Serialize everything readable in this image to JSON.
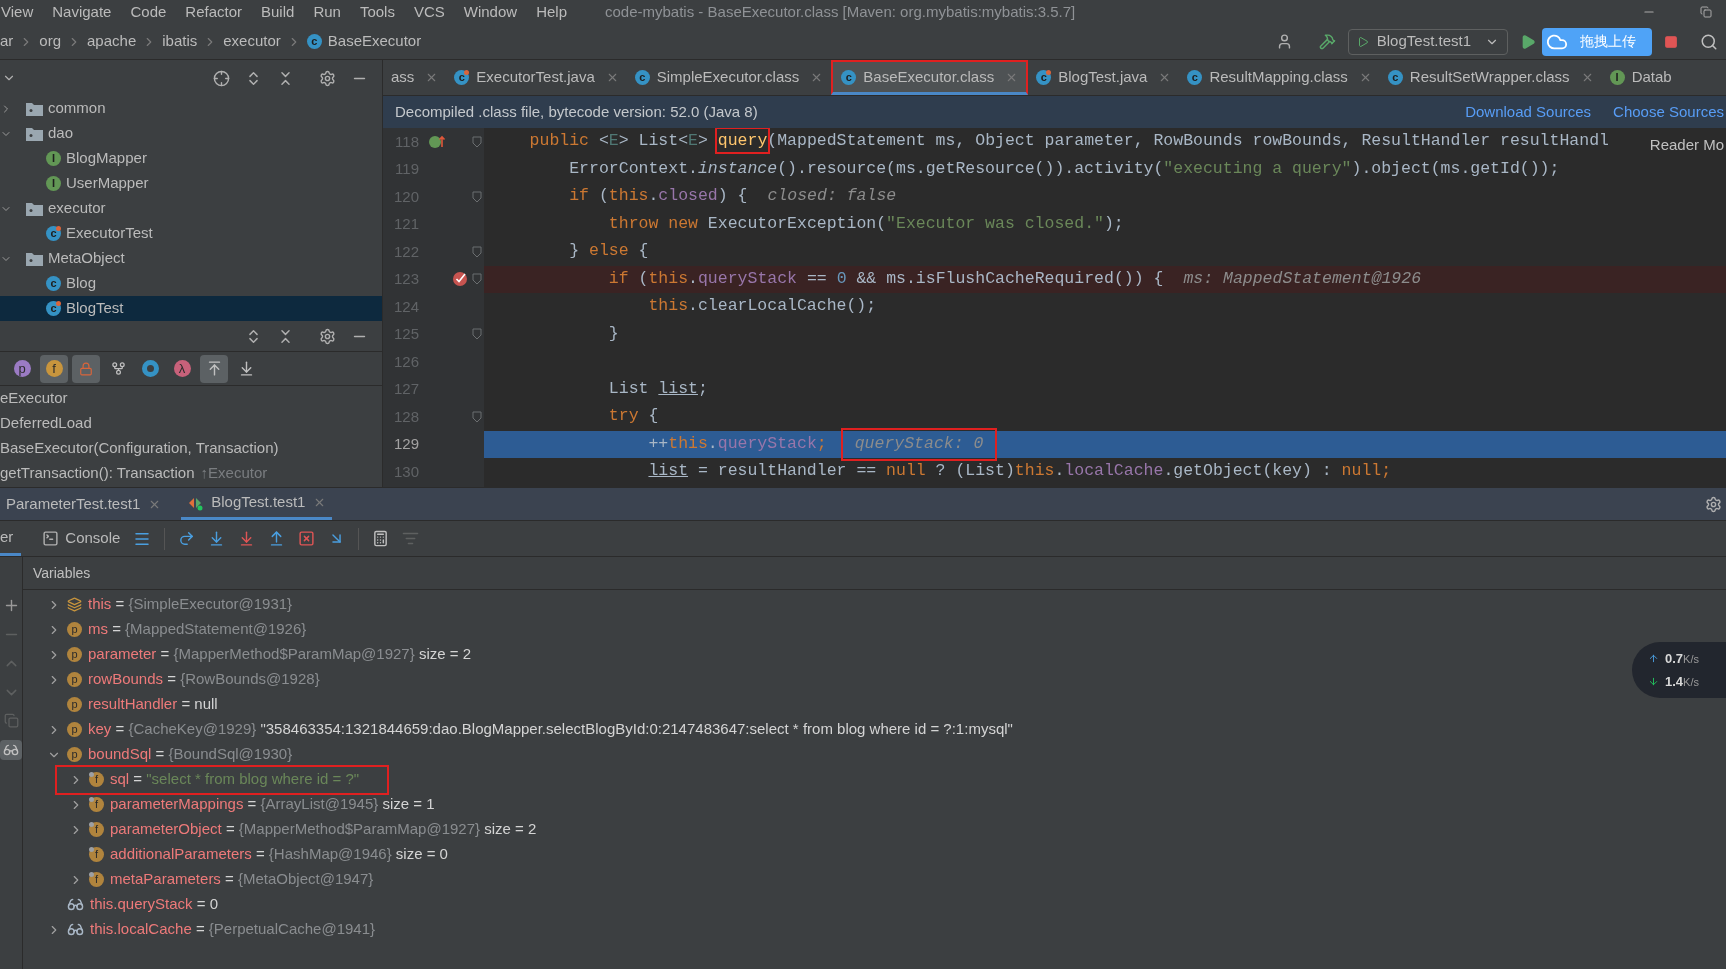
{
  "menu": [
    "View",
    "Navigate",
    "Code",
    "Refactor",
    "Build",
    "Run",
    "Tools",
    "VCS",
    "Window",
    "Help"
  ],
  "window": {
    "title": "code-mybatis - BaseExecutor.class [Maven: org.mybatis:mybatis:3.5.7]"
  },
  "breadcrumbs": [
    {
      "label": "ar"
    },
    {
      "label": "org"
    },
    {
      "label": "apache"
    },
    {
      "label": "ibatis"
    },
    {
      "label": "executor"
    },
    {
      "label": "BaseExecutor",
      "glyph": "c"
    }
  ],
  "run_config": {
    "label": "BlogTest.test1"
  },
  "upload_button": {
    "label": "拖拽上传"
  },
  "project_tree": [
    {
      "label": "common",
      "kind": "folder",
      "expanded": false,
      "selected": false
    },
    {
      "label": "dao",
      "kind": "folder",
      "expanded": true,
      "selected": false,
      "children": [
        {
          "label": "BlogMapper",
          "kind": "interface",
          "glyph": "I",
          "selected": false
        },
        {
          "label": "UserMapper",
          "kind": "interface",
          "glyph": "I",
          "selected": false
        }
      ]
    },
    {
      "label": "executor",
      "kind": "folder",
      "expanded": true,
      "selected": false,
      "children": [
        {
          "label": "ExecutorTest",
          "kind": "test",
          "glyph": "c",
          "selected": false
        }
      ]
    },
    {
      "label": "MetaObject",
      "kind": "folder",
      "expanded": true,
      "selected": false,
      "children": [
        {
          "label": "Blog",
          "kind": "class",
          "glyph": "c",
          "selected": false
        },
        {
          "label": "BlogTest",
          "kind": "test",
          "glyph": "c",
          "selected": true
        }
      ]
    }
  ],
  "structure_filters": [
    {
      "kind": "property",
      "glyph": "p",
      "selected": false
    },
    {
      "kind": "field",
      "glyph": "f",
      "selected": true
    },
    {
      "kind": "lock",
      "selected": true
    },
    {
      "kind": "fork",
      "selected": false
    },
    {
      "kind": "ring",
      "selected": false
    },
    {
      "kind": "lambda",
      "glyph": "λ",
      "selected": false
    },
    {
      "kind": "inherited",
      "selected": true
    },
    {
      "kind": "down",
      "selected": false
    }
  ],
  "structure_items": [
    {
      "label": "eExecutor"
    },
    {
      "label": "DeferredLoad"
    },
    {
      "label": "BaseExecutor(Configuration, Transaction)"
    },
    {
      "label": "getTransaction(): Transaction",
      "origin": "↑Executor"
    }
  ],
  "editor_tabs": [
    {
      "label": "ass",
      "selected": false,
      "close": true
    },
    {
      "label": "ExecutorTest.java",
      "kind": "test",
      "glyph": "c",
      "selected": false,
      "close": true
    },
    {
      "label": "SimpleExecutor.class",
      "kind": "class",
      "glyph": "c",
      "selected": false,
      "close": true
    },
    {
      "label": "BaseExecutor.class",
      "kind": "class",
      "glyph": "c",
      "selected": true,
      "close": true,
      "boxed": true
    },
    {
      "label": "BlogTest.java",
      "kind": "test",
      "glyph": "c",
      "selected": false,
      "close": true
    },
    {
      "label": "ResultMapping.class",
      "kind": "class",
      "glyph": "c",
      "selected": false,
      "close": true
    },
    {
      "label": "ResultSetWrapper.class",
      "kind": "class",
      "glyph": "c",
      "selected": false,
      "close": true
    },
    {
      "label": "Datab",
      "kind": "interface",
      "glyph": "I",
      "selected": false,
      "close": false
    }
  ],
  "banner": {
    "text": "Decompiled .class file, bytecode version: 52.0 (Java 8)",
    "links": [
      "Download Sources",
      "Choose Sources"
    ]
  },
  "reader_mode": "Reader Mo",
  "code_lines": [
    {
      "number": "118",
      "kind": "override",
      "fold": true,
      "current": false,
      "tokens": [
        {
          "text": "    public",
          "kind": "kw"
        },
        {
          "text": " <",
          "kind": "plain"
        },
        {
          "text": "E",
          "kind": "type"
        },
        {
          "text": "> List<",
          "kind": "plain"
        },
        {
          "text": "E",
          "kind": "type"
        },
        {
          "text": "> ",
          "kind": "plain"
        },
        {
          "text": "query",
          "kind": "fn",
          "boxed": true
        },
        {
          "text": "(MappedStatement ms, Object parameter, RowBounds rowBounds, ResultHandler resultHandl",
          "kind": "plain"
        }
      ]
    },
    {
      "number": "119",
      "kind": "plain",
      "fold": false,
      "current": false,
      "tokens": [
        {
          "text": "        ErrorContext.",
          "kind": "plain"
        },
        {
          "text": "instance",
          "kind": "italic"
        },
        {
          "text": "().resource(ms.getResource()).activity(",
          "kind": "plain"
        },
        {
          "text": "\"executing a query\"",
          "kind": "str"
        },
        {
          "text": ").object(ms.getId());",
          "kind": "plain"
        }
      ]
    },
    {
      "number": "120",
      "kind": "plain",
      "fold": true,
      "current": false,
      "tokens": [
        {
          "text": "        if",
          "kind": "kw"
        },
        {
          "text": " (",
          "kind": "plain"
        },
        {
          "text": "this",
          "kind": "kw"
        },
        {
          "text": ".",
          "kind": "plain"
        },
        {
          "text": "closed",
          "kind": "field"
        },
        {
          "text": ") {",
          "kind": "plain"
        }
      ],
      "hint": "closed: false"
    },
    {
      "number": "121",
      "kind": "plain",
      "fold": false,
      "current": false,
      "tokens": [
        {
          "text": "            throw new",
          "kind": "kw"
        },
        {
          "text": " ExecutorException(",
          "kind": "plain"
        },
        {
          "text": "\"Executor was closed.\"",
          "kind": "str"
        },
        {
          "text": ");",
          "kind": "plain"
        }
      ]
    },
    {
      "number": "122",
      "kind": "plain",
      "fold": true,
      "current": false,
      "tokens": [
        {
          "text": "        } ",
          "kind": "plain"
        },
        {
          "text": "else",
          "kind": "kw"
        },
        {
          "text": " {",
          "kind": "plain"
        }
      ]
    },
    {
      "number": "123",
      "kind": "breakpoint",
      "fold": true,
      "current": false,
      "tokens": [
        {
          "text": "            if",
          "kind": "kw"
        },
        {
          "text": " (",
          "kind": "plain"
        },
        {
          "text": "this",
          "kind": "kw"
        },
        {
          "text": ".",
          "kind": "plain"
        },
        {
          "text": "queryStack",
          "kind": "field"
        },
        {
          "text": " == ",
          "kind": "plain"
        },
        {
          "text": "0",
          "kind": "num"
        },
        {
          "text": " && ms.isFlushCacheRequired()) {",
          "kind": "plain"
        }
      ],
      "hint": "ms: MappedStatement@1926"
    },
    {
      "number": "124",
      "kind": "plain",
      "fold": false,
      "current": false,
      "tokens": [
        {
          "text": "                this",
          "kind": "kw"
        },
        {
          "text": ".clearLocalCache();",
          "kind": "plain"
        }
      ]
    },
    {
      "number": "125",
      "kind": "plain",
      "fold": true,
      "current": false,
      "tokens": [
        {
          "text": "            }",
          "kind": "plain"
        }
      ]
    },
    {
      "number": "126",
      "kind": "plain",
      "fold": false,
      "current": false
    },
    {
      "number": "127",
      "kind": "plain",
      "fold": false,
      "current": false,
      "tokens": [
        {
          "text": "            List ",
          "kind": "plain"
        },
        {
          "text": "list",
          "kind": "underline"
        },
        {
          "text": ";",
          "kind": "plain"
        }
      ]
    },
    {
      "number": "128",
      "kind": "plain",
      "fold": true,
      "current": false,
      "tokens": [
        {
          "text": "            try",
          "kind": "kw"
        },
        {
          "text": " {",
          "kind": "plain"
        }
      ]
    },
    {
      "number": "129",
      "kind": "plain",
      "fold": false,
      "current": true,
      "tokens": [
        {
          "text": "                ++",
          "kind": "plain"
        },
        {
          "text": "this",
          "kind": "kw"
        },
        {
          "text": ".",
          "kind": "plain"
        },
        {
          "text": "queryStack",
          "kind": "field"
        },
        {
          "text": ";",
          "kind": "kw"
        }
      ],
      "hint": "queryStack: 0",
      "hint_boxed": true
    },
    {
      "number": "130",
      "kind": "plain",
      "fold": false,
      "current": false,
      "tokens": [
        {
          "text": "                list",
          "kind": "underline"
        },
        {
          "text": " = resultHandler == ",
          "kind": "plain"
        },
        {
          "text": "null",
          "kind": "kw"
        },
        {
          "text": " ? (List)",
          "kind": "plain"
        },
        {
          "text": "this",
          "kind": "kw"
        },
        {
          "text": ".",
          "kind": "plain"
        },
        {
          "text": "localCache",
          "kind": "field"
        },
        {
          "text": ".getObject(key) : ",
          "kind": "plain"
        },
        {
          "text": "null",
          "kind": "kw"
        },
        {
          "text": ";",
          "kind": "kw"
        }
      ]
    }
  ],
  "debug_tabs": [
    {
      "label": "ParameterTest.test1",
      "selected": false
    },
    {
      "label": "BlogTest.test1",
      "selected": true
    }
  ],
  "debug_views": [
    {
      "label": "er",
      "selected": true
    },
    {
      "label": "Console",
      "selected": false
    }
  ],
  "variables_header": "Variables",
  "variables": [
    {
      "kind": "object",
      "name": "this",
      "op": "=",
      "ref": "{SimpleExecutor@1931}",
      "expanded": false
    },
    {
      "kind": "param",
      "glyph": "p",
      "name": "ms",
      "op": "=",
      "ref": "{MappedStatement@1926}",
      "expanded": false
    },
    {
      "kind": "param",
      "glyph": "p",
      "name": "parameter",
      "op": "=",
      "ref": "{MapperMethod$ParamMap@1927}",
      "detail": "size = 2",
      "expanded": false
    },
    {
      "kind": "param",
      "glyph": "p",
      "name": "rowBounds",
      "op": "=",
      "ref": "{RowBounds@1928}",
      "expanded": false
    },
    {
      "kind": "param",
      "glyph": "p",
      "name": "resultHandler",
      "op": "=",
      "value": "null"
    },
    {
      "kind": "param",
      "glyph": "p",
      "name": "key",
      "op": "=",
      "ref": "{CacheKey@1929}",
      "detail": "\"358463354:1321844659:dao.BlogMapper.selectBlogById:0:2147483647:select * from blog where id = ?:1:mysql\"",
      "expanded": false
    },
    {
      "kind": "param",
      "glyph": "p",
      "name": "boundSql",
      "op": "=",
      "ref": "{BoundSql@1930}",
      "expanded": true,
      "children": [
        {
          "kind": "field",
          "glyph": "f",
          "name": "sql",
          "op": "=",
          "string": "\"select * from blog where id = ?\"",
          "expanded": false,
          "boxed": true
        },
        {
          "kind": "field",
          "glyph": "f",
          "name": "parameterMappings",
          "op": "=",
          "ref": "{ArrayList@1945}",
          "detail": "size = 1",
          "expanded": false
        },
        {
          "kind": "field",
          "glyph": "f",
          "name": "parameterObject",
          "op": "=",
          "ref": "{MapperMethod$ParamMap@1927}",
          "detail": "size = 2",
          "expanded": false
        },
        {
          "kind": "field",
          "glyph": "f",
          "name": "additionalParameters",
          "op": "=",
          "ref": "{HashMap@1946}",
          "detail": "size = 0"
        },
        {
          "kind": "field",
          "glyph": "f",
          "name": "metaParameters",
          "op": "=",
          "ref": "{MetaObject@1947}",
          "expanded": false
        }
      ]
    },
    {
      "kind": "watch",
      "name": "this.queryStack",
      "op": "=",
      "value": "0"
    },
    {
      "kind": "watch",
      "name": "this.localCache",
      "op": "=",
      "ref": "{PerpetualCache@1941}",
      "expanded": false
    }
  ],
  "net_speed": [
    {
      "kind": "up",
      "value": "0.7",
      "unit": "K/s"
    },
    {
      "kind": "down",
      "value": "1.4",
      "unit": "K/s"
    }
  ]
}
